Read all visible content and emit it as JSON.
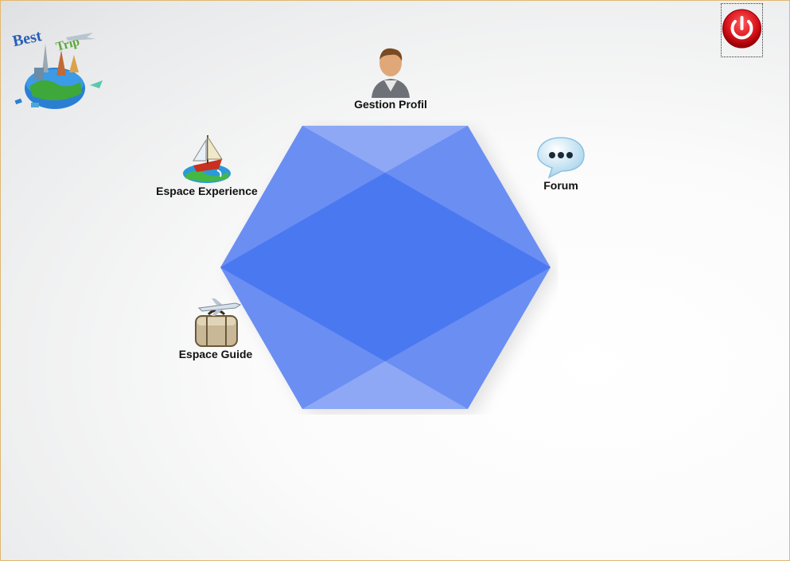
{
  "nav": {
    "profil": {
      "label": "Gestion Profil",
      "icon": "user-avatar-icon"
    },
    "forum": {
      "label": "Forum",
      "icon": "chat-bubble-icon"
    },
    "experience": {
      "label": "Espace Experience",
      "icon": "sailboat-globe-icon"
    },
    "guide": {
      "label": "Espace Guide",
      "icon": "luggage-plane-icon"
    }
  },
  "logo": {
    "text_top": "Best",
    "text_right": "Trip"
  },
  "power_button": {
    "icon": "power-icon"
  },
  "colors": {
    "hexagon": "#4a78f0",
    "hexagon_light": "#8ea8f6",
    "power_red": "#e01b22",
    "frame_border": "#e0b870"
  }
}
